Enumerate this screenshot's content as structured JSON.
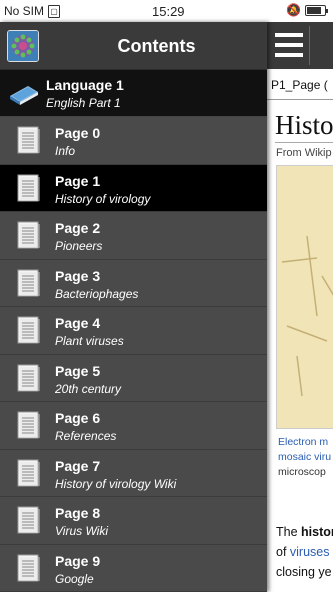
{
  "status_bar": {
    "carrier": "No SIM",
    "time": "15:29",
    "battery_level": 0.85
  },
  "drawer": {
    "title": "Contents",
    "app_icon": "virus-app-icon",
    "language": {
      "title": "Language 1",
      "subtitle": "English Part 1"
    },
    "pages": [
      {
        "title": "Page 0",
        "subtitle": "Info",
        "active": false
      },
      {
        "title": "Page 1",
        "subtitle": "History of virology",
        "active": true
      },
      {
        "title": "Page 2",
        "subtitle": "Pioneers",
        "active": false
      },
      {
        "title": "Page 3",
        "subtitle": "Bacteriophages",
        "active": false
      },
      {
        "title": "Page 4",
        "subtitle": "Plant viruses",
        "active": false
      },
      {
        "title": "Page 5",
        "subtitle": "20th century",
        "active": false
      },
      {
        "title": "Page 6",
        "subtitle": "References",
        "active": false
      },
      {
        "title": "Page 7",
        "subtitle": "History of virology Wiki",
        "active": false
      },
      {
        "title": "Page 8",
        "subtitle": "Virus Wiki",
        "active": false
      },
      {
        "title": "Page 9",
        "subtitle": "Google",
        "active": false
      }
    ]
  },
  "content": {
    "page_label": "P1_Page (",
    "article_title": "Histo",
    "from_wiki": "From Wikip",
    "caption_lines": [
      "Electron m",
      "mosaic viru",
      "microscop"
    ],
    "body_lines": [
      {
        "prefix": "The ",
        "bold": "histor",
        "link": ""
      },
      {
        "prefix": "of ",
        "bold": "",
        "link": "viruses"
      },
      {
        "prefix": "closing ye",
        "bold": "",
        "link": ""
      }
    ]
  },
  "colors": {
    "drawer_bg": "#454545",
    "active_row": "#000000",
    "header_bg": "#3a3a3a",
    "link": "#2a5db0"
  }
}
